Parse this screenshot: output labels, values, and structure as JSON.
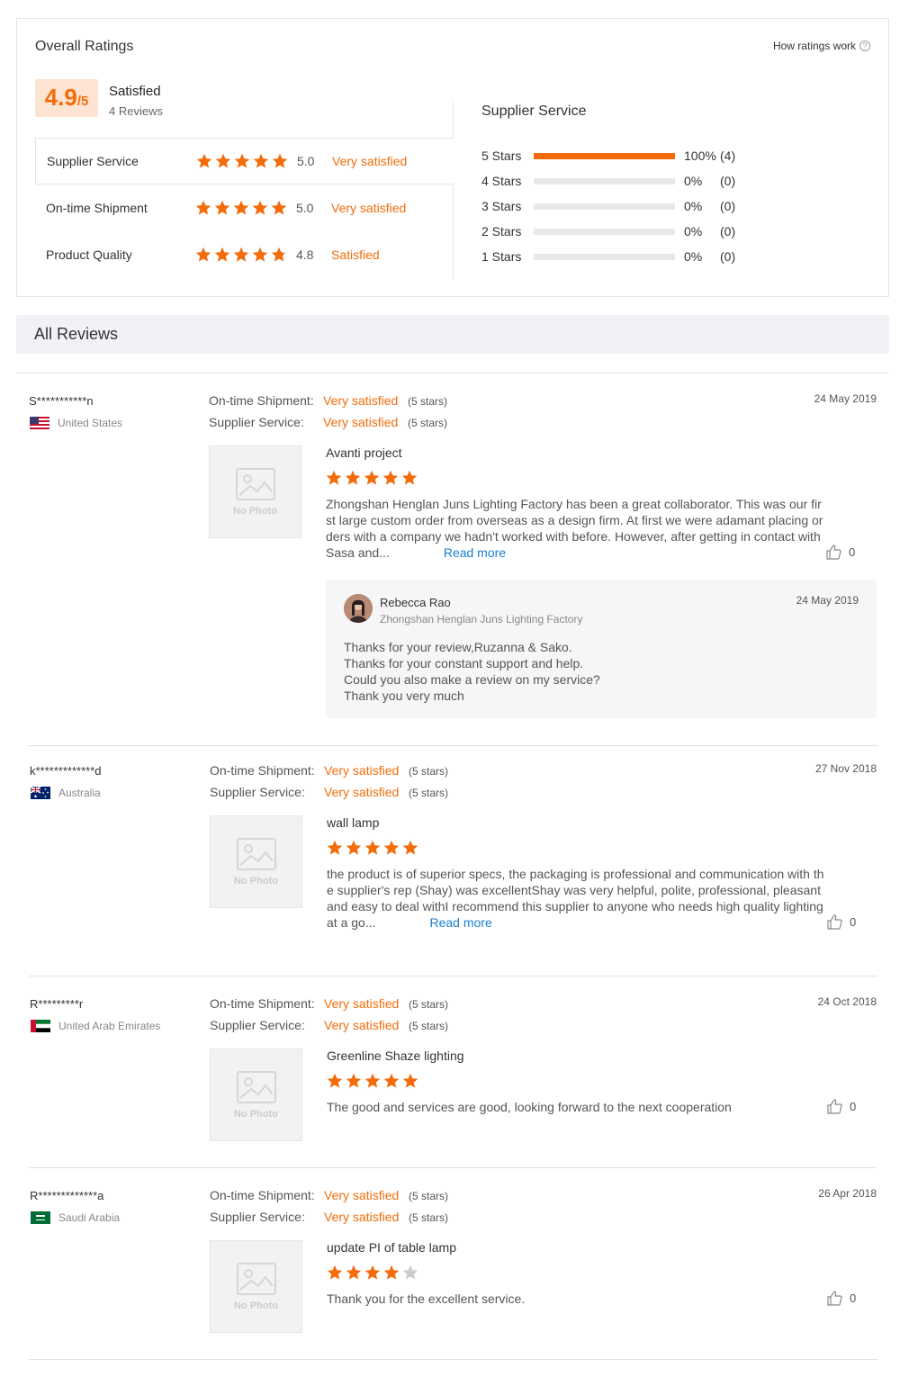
{
  "overall": {
    "title": "Overall Ratings",
    "how_link": "How ratings work",
    "score": "4.9",
    "score_max": "/5",
    "summary": "Satisfied",
    "reviews_count": "4 Reviews",
    "categories": [
      {
        "name": "Supplier Service",
        "score": "5.0",
        "label": "Very satisfied",
        "stars": 5
      },
      {
        "name": "On-time Shipment",
        "score": "5.0",
        "label": "Very satisfied",
        "stars": 5
      },
      {
        "name": "Product Quality",
        "score": "4.8",
        "label": "Satisfied",
        "stars": 4.8
      }
    ]
  },
  "distribution": {
    "title": "Supplier Service",
    "rows": [
      {
        "label": "5  Stars",
        "pct": "100%",
        "count": "(4)",
        "fraction": 1.0
      },
      {
        "label": "4  Stars",
        "pct": "0%",
        "count": "(0)",
        "fraction": 0
      },
      {
        "label": "3  Stars",
        "pct": "0%",
        "count": "(0)",
        "fraction": 0
      },
      {
        "label": "2  Stars",
        "pct": "0%",
        "count": "(0)",
        "fraction": 0
      },
      {
        "label": "1  Stars",
        "pct": "0%",
        "count": "(0)",
        "fraction": 0
      }
    ]
  },
  "all_reviews_title": "All Reviews",
  "meta_labels": {
    "shipment": "On-time Shipment:",
    "service": "Supplier Service:"
  },
  "no_photo": "No Photo",
  "reviews": [
    {
      "name": "S***********n",
      "country": "United States",
      "shipment": "Very satisfied",
      "shipment_stars": "(5 stars)",
      "service": "Very satisfied",
      "service_stars": "(5 stars)",
      "date": "24 May 2019",
      "title": "Avanti project",
      "rating": 5,
      "body": "Zhongshan Henglan Juns Lighting Factory has been a great collaborator.  This was our first large custom order from overseas as a design firm.  At first we were adamant placing orders with a company we hadn't worked with before.  However, after getting in contact with Sasa and...",
      "read_more": "Read more",
      "likes": "0",
      "reply": {
        "name": "Rebecca Rao",
        "company": "Zhongshan Henglan Juns Lighting Factory",
        "date": "24 May 2019",
        "lines": [
          "Thanks for your review,Ruzanna & Sako.",
          "Thanks for your constant support and help.",
          "Could you also make a review on my service?",
          "Thank you very much"
        ]
      }
    },
    {
      "name": "k*************d",
      "country": "Australia",
      "shipment": "Very satisfied",
      "shipment_stars": "(5 stars)",
      "service": "Very satisfied",
      "service_stars": "(5 stars)",
      "date": "27 Nov 2018",
      "title": "wall lamp",
      "rating": 5,
      "body": "the product is of superior specs, the packaging is professional and communication with the supplier's rep (Shay) was excellentShay was very helpful, polite, professional, pleasant and easy to deal withI recommend this supplier to anyone who needs high quality lighting at a go...",
      "read_more": "Read more",
      "likes": "0"
    },
    {
      "name": "R*********r",
      "country": "United Arab Emirates",
      "shipment": "Very satisfied",
      "shipment_stars": "(5 stars)",
      "service": "Very satisfied",
      "service_stars": "(5 stars)",
      "date": "24 Oct 2018",
      "title": "Greenline Shaze lighting",
      "rating": 5,
      "body": "The good and services are good, looking forward to the next cooperation",
      "likes": "0"
    },
    {
      "name": "R*************a",
      "country": "Saudi Arabia",
      "shipment": "Very satisfied",
      "shipment_stars": "(5 stars)",
      "service": "Very satisfied",
      "service_stars": "(5 stars)",
      "date": "26 Apr 2018",
      "title": "update PI of table lamp",
      "rating": 4,
      "body": "Thank you for the excellent service.",
      "likes": "0"
    }
  ],
  "colors": {
    "accent": "#f36c0b",
    "link": "#1a7fcf",
    "star_empty": "#cccccc"
  }
}
